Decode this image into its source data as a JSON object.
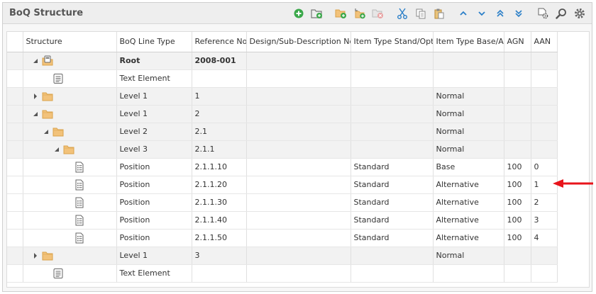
{
  "panel": {
    "title": "BoQ Structure"
  },
  "toolbar": {
    "icons": [
      "add-circle-icon",
      "new-folder-icon",
      "insert-folder-icon",
      "insert-subfolder-icon",
      "delete-folder-icon",
      "cut-icon",
      "copy-icon",
      "paste-icon",
      "move-up-icon",
      "move-down-icon",
      "move-top-icon",
      "move-bottom-icon",
      "settings-document-icon",
      "search-icon",
      "gear-icon"
    ]
  },
  "columns": [
    "Structure",
    "BoQ Line Type",
    "Reference No.",
    "Design/Sub-Description No.",
    "Item Type Stand/Opt",
    "Item Type Base/Alt",
    "AGN",
    "AAN"
  ],
  "rows": [
    {
      "level": 0,
      "expand": "open",
      "icon": "root",
      "bold": true,
      "shade": true,
      "line_type": "Root",
      "ref": "2008-001",
      "design": "",
      "stand_opt": "",
      "base_alt": "",
      "agn": "",
      "aan": ""
    },
    {
      "level": 1,
      "expand": "none",
      "icon": "text",
      "bold": false,
      "shade": false,
      "line_type": "Text Element",
      "ref": "",
      "design": "",
      "stand_opt": "",
      "base_alt": "",
      "agn": "",
      "aan": ""
    },
    {
      "level": 0,
      "expand": "closed",
      "icon": "folder",
      "bold": false,
      "shade": true,
      "line_type": "Level 1",
      "ref": "1",
      "design": "",
      "stand_opt": "",
      "base_alt": "Normal",
      "agn": "",
      "aan": ""
    },
    {
      "level": 0,
      "expand": "open",
      "icon": "folder",
      "bold": false,
      "shade": true,
      "line_type": "Level 1",
      "ref": "2",
      "design": "",
      "stand_opt": "",
      "base_alt": "Normal",
      "agn": "",
      "aan": ""
    },
    {
      "level": 1,
      "expand": "open",
      "icon": "folder",
      "bold": false,
      "shade": true,
      "line_type": "Level 2",
      "ref": "2.1",
      "design": "",
      "stand_opt": "",
      "base_alt": "Normal",
      "agn": "",
      "aan": ""
    },
    {
      "level": 2,
      "expand": "open",
      "icon": "folder",
      "bold": false,
      "shade": true,
      "line_type": "Level 3",
      "ref": "2.1.1",
      "design": "",
      "stand_opt": "",
      "base_alt": "Normal",
      "agn": "",
      "aan": ""
    },
    {
      "level": 3,
      "expand": "none",
      "icon": "position",
      "bold": false,
      "shade": false,
      "line_type": "Position",
      "ref": "2.1.1.10",
      "design": "",
      "stand_opt": "Standard",
      "base_alt": "Base",
      "agn": "100",
      "aan": "0"
    },
    {
      "level": 3,
      "expand": "none",
      "icon": "position",
      "bold": false,
      "shade": false,
      "line_type": "Position",
      "ref": "2.1.1.20",
      "design": "",
      "stand_opt": "Standard",
      "base_alt": "Alternative",
      "agn": "100",
      "aan": "1"
    },
    {
      "level": 3,
      "expand": "none",
      "icon": "position",
      "bold": false,
      "shade": false,
      "line_type": "Position",
      "ref": "2.1.1.30",
      "design": "",
      "stand_opt": "Standard",
      "base_alt": "Alternative",
      "agn": "100",
      "aan": "2"
    },
    {
      "level": 3,
      "expand": "none",
      "icon": "position",
      "bold": false,
      "shade": false,
      "line_type": "Position",
      "ref": "2.1.1.40",
      "design": "",
      "stand_opt": "Standard",
      "base_alt": "Alternative",
      "agn": "100",
      "aan": "3"
    },
    {
      "level": 3,
      "expand": "none",
      "icon": "position",
      "bold": false,
      "shade": false,
      "line_type": "Position",
      "ref": "2.1.1.50",
      "design": "",
      "stand_opt": "Standard",
      "base_alt": "Alternative",
      "agn": "100",
      "aan": "4"
    },
    {
      "level": 0,
      "expand": "closed",
      "icon": "folder",
      "bold": false,
      "shade": true,
      "line_type": "Level 1",
      "ref": "3",
      "design": "",
      "stand_opt": "",
      "base_alt": "Normal",
      "agn": "",
      "aan": ""
    },
    {
      "level": 1,
      "expand": "none",
      "icon": "text",
      "bold": false,
      "shade": false,
      "line_type": "Text Element",
      "ref": "",
      "design": "",
      "stand_opt": "",
      "base_alt": "",
      "agn": "",
      "aan": ""
    }
  ],
  "annotation": {
    "icon": "red-arrow-icon",
    "color": "#e8141b"
  },
  "colors": {
    "toolbar_blue": "#2a7fc8",
    "add_green": "#3aa84a",
    "folder": "#f2c27a",
    "folder_dark": "#d9a24a"
  }
}
